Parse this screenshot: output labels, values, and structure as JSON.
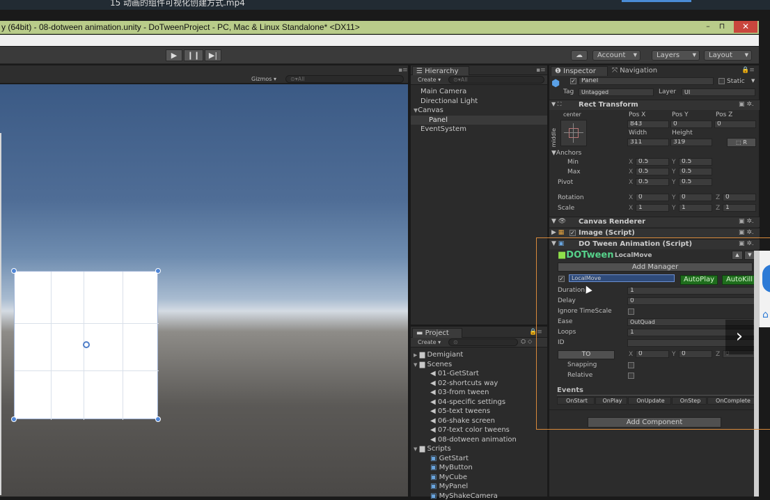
{
  "video_filename": "15 动画的组件可视化创建方式.mp4",
  "window": {
    "title": "y (64bit) - 08-dotween animation.unity - DoTweenProject - PC, Mac & Linux Standalone* <DX11>",
    "minimize": "–",
    "maximize": "⊓",
    "close": "✕"
  },
  "toolbar": {
    "play": "▶",
    "pause": "❙❙",
    "step": "▶|",
    "cloud": "☁",
    "account": "Account",
    "layers": "Layers",
    "layout": "Layout"
  },
  "scene": {
    "gizmos": "Gizmos",
    "search_placeholder": "All"
  },
  "hierarchy": {
    "tab": "Hierarchy",
    "create": "Create",
    "search_placeholder": "All",
    "items": [
      "Main Camera",
      "Directional Light",
      "Canvas",
      "Panel",
      "EventSystem"
    ]
  },
  "project": {
    "tab": "Project",
    "create": "Create",
    "folders": [
      "Demigiant",
      "Scenes",
      "Scripts"
    ],
    "scenes": [
      "01-GetStart",
      "02-shortcuts way",
      "03-from tween",
      "04-specific settings",
      "05-text tweens",
      "06-shake screen",
      "07-text color tweens",
      "08-dotween animation"
    ],
    "scripts": [
      "GetStart",
      "MyButton",
      "MyCube",
      "MyPanel",
      "MyShakeCamera"
    ]
  },
  "inspector": {
    "tab_inspector": "Inspector",
    "tab_navigation": "Navigation",
    "object_name": "Panel",
    "static": "Static",
    "tag_label": "Tag",
    "tag_value": "Untagged",
    "layer_label": "Layer",
    "layer_value": "UI",
    "rect_transform": {
      "title": "Rect Transform",
      "anchor_h": "center",
      "anchor_v": "middle",
      "posx_label": "Pos X",
      "posy_label": "Pos Y",
      "posz_label": "Pos Z",
      "posx": "843",
      "posy": "0",
      "posz": "0",
      "width_label": "Width",
      "height_label": "Height",
      "width": "311",
      "height": "319",
      "r_button": "R",
      "anchors": "Anchors",
      "min": "Min",
      "max": "Max",
      "pivot": "Pivot",
      "min_x": "0.5",
      "min_y": "0.5",
      "max_x": "0.5",
      "max_y": "0.5",
      "pivot_x": "0.5",
      "pivot_y": "0.5",
      "rotation": "Rotation",
      "rot_x": "0",
      "rot_y": "0",
      "rot_z": "0",
      "scale": "Scale",
      "scale_x": "1",
      "scale_y": "1",
      "scale_z": "1",
      "x": "X",
      "y": "Y",
      "z": "Z"
    },
    "canvas_renderer": "Canvas Renderer",
    "image_script": "Image (Script)",
    "dotween": {
      "title": "DO Tween Animation (Script)",
      "logo": "DOTween",
      "subtitle": "LocalMove",
      "add_manager": "Add Manager",
      "animation_type": "LocalMove",
      "autoplay": "AutoPlay",
      "autokill": "AutoKill",
      "duration_label": "Duration",
      "duration": "1",
      "delay_label": "Delay",
      "delay": "0",
      "ignore_timescale": "Ignore TimeScale",
      "ease_label": "Ease",
      "ease": "OutQuad",
      "loops_label": "Loops",
      "loops": "1",
      "id_label": "ID",
      "id": "",
      "to_button": "TO",
      "to_x": "0",
      "to_y": "0",
      "to_z": "0",
      "snapping": "Snapping",
      "relative": "Relative",
      "events": "Events",
      "event_tabs": [
        "OnStart",
        "OnPlay",
        "OnUpdate",
        "OnStep",
        "OnComplete"
      ]
    },
    "add_component": "Add Component"
  }
}
